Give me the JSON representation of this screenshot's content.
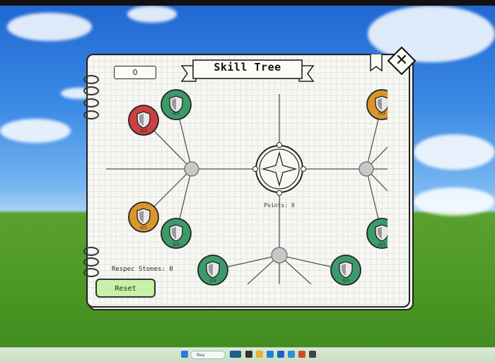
{
  "screen": {
    "palette": {
      "sky": "#2f7ad8",
      "grass": "#4f9a26",
      "taskbar": "#cfe3cb"
    },
    "taskbar": {
      "search_label": "Rea"
    }
  },
  "skill_tree_window": {
    "title": "Skill Tree",
    "points_counter": "0",
    "points_label": "Points: 0",
    "respec_label": "Respec Stones: 0",
    "reset_label": "Reset",
    "close_symbol": "✕",
    "colors": {
      "locked": "#3d9a6a",
      "available": "#d9962d",
      "maxed": "#cc4040",
      "reset_button": "#c7f0a8",
      "paper": "#f7f7f3"
    },
    "skill_nodes": [
      {
        "id": "node-a",
        "status": "locked",
        "rank": "0/3"
      },
      {
        "id": "node-b",
        "status": "maxed",
        "rank": "0/3"
      },
      {
        "id": "node-c",
        "status": "available",
        "rank": "0/1"
      },
      {
        "id": "node-d",
        "status": "locked",
        "rank": "0/3"
      },
      {
        "id": "node-e",
        "status": "locked",
        "rank": "0/3"
      },
      {
        "id": "node-f",
        "status": "locked",
        "rank": "0/3"
      },
      {
        "id": "node-g",
        "status": "available",
        "rank": "0/3"
      },
      {
        "id": "node-h",
        "status": "locked",
        "rank": "0/3"
      }
    ]
  }
}
